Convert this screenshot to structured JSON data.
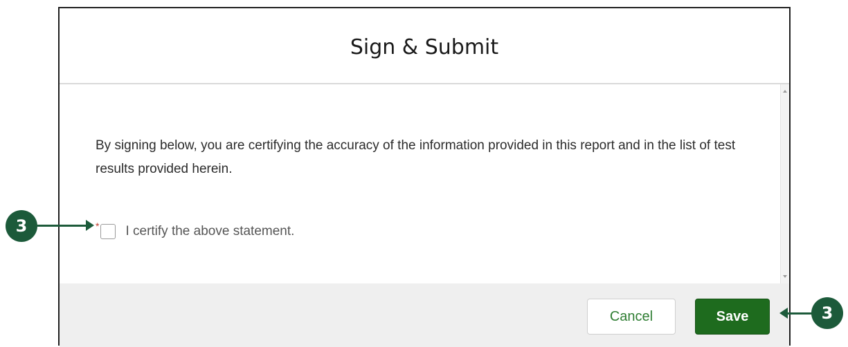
{
  "dialog": {
    "title": "Sign & Submit",
    "statement": "By signing below, you are certifying the accuracy of the information provided in this report and in the list of test results provided herein.",
    "certify": {
      "required_marker": "*",
      "label": "I certify the above statement.",
      "checked": false
    },
    "footer": {
      "cancel_label": "Cancel",
      "save_label": "Save"
    }
  },
  "annotations": {
    "left_callout": "3",
    "right_callout": "3"
  },
  "colors": {
    "primary": "#1e6b1e",
    "callout": "#1c5a3a",
    "required": "#c0392b",
    "footer_bg": "#efefef"
  }
}
